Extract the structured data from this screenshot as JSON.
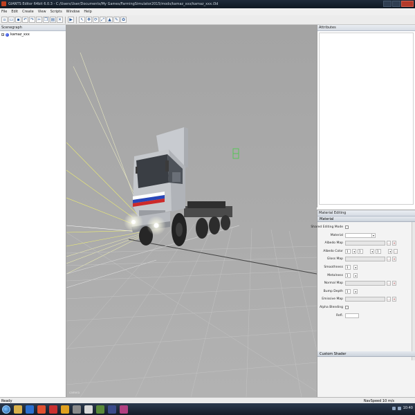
{
  "window": {
    "title": "GIANTS Editor 64bit 6.0.3 - C:/Users/User/Documents/My Games/FarmingSimulator2015/mods/kamaz_xxx/kamaz_xxx.i3d"
  },
  "menu": {
    "items": [
      "File",
      "Edit",
      "Create",
      "View",
      "Scripts",
      "Window",
      "Help"
    ]
  },
  "toolbar": {
    "buttons": [
      "new-icon",
      "open-icon",
      "save-icon",
      "undo-icon",
      "redo-icon",
      "cut-icon",
      "copy-icon",
      "paste-icon",
      "delete-icon",
      "play-icon",
      "select-icon",
      "move-icon",
      "rotate-icon",
      "scale-icon",
      "terrain-icon",
      "paint-icon",
      "foliage-icon"
    ]
  },
  "scenegraph": {
    "header": "Scenegraph",
    "nodes": [
      {
        "label": "kamaz_xxx",
        "icon": "transform-node-icon"
      }
    ]
  },
  "viewport": {
    "label": "camera"
  },
  "attributes": {
    "header": "Attributes"
  },
  "material": {
    "header": "Material Editing",
    "section": "Material",
    "rows": [
      {
        "label": "Shared Editing Mode",
        "kind": "check"
      },
      {
        "label": "Material",
        "kind": "dropdown"
      },
      {
        "label": "Albedo Map",
        "kind": "map"
      },
      {
        "label": "Albedo Color",
        "kind": "color",
        "values": [
          "1",
          "1",
          "1"
        ]
      },
      {
        "label": "Gloss Map",
        "kind": "map"
      },
      {
        "label": "Smoothness",
        "kind": "num",
        "value": "1"
      },
      {
        "label": "Metalness",
        "kind": "num",
        "value": "1"
      },
      {
        "label": "Normal Map",
        "kind": "map"
      },
      {
        "label": "Bump Depth",
        "kind": "num",
        "value": "1"
      },
      {
        "label": "Emissive Map",
        "kind": "map"
      },
      {
        "label": "Alpha Blending",
        "kind": "check"
      },
      {
        "label": "Refl.",
        "kind": "short"
      }
    ],
    "custom_shader": "Custom Shader"
  },
  "status": {
    "left": "Ready",
    "right": "NavSpeed 10 m/s"
  },
  "taskbar": {
    "clock": "10:40"
  },
  "colors": {
    "viewport_bg": "#a9a9a9",
    "truck_cab": "#c5c8cc",
    "accent": "#1f5a9e"
  }
}
